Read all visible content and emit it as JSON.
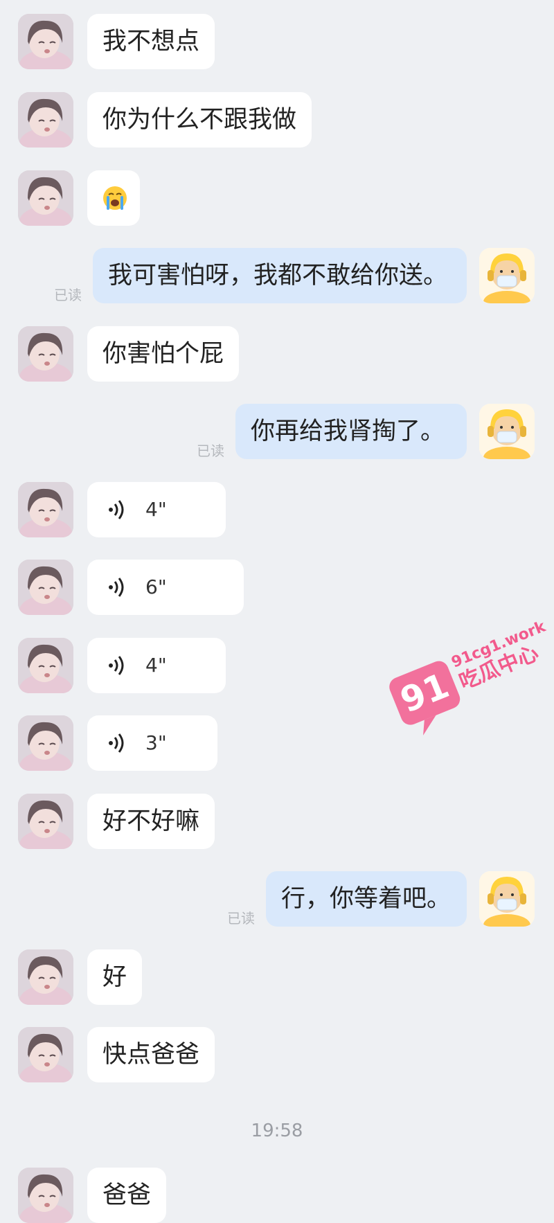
{
  "messages": [
    {
      "side": "left",
      "text": "我不想点"
    },
    {
      "side": "left",
      "text": "你为什么不跟我做"
    },
    {
      "side": "left",
      "emoji": "loudly-crying-face"
    },
    {
      "side": "right",
      "text": "我可害怕呀，我都不敢给你送。",
      "status": "已读"
    },
    {
      "side": "left",
      "text": "你害怕个屁"
    },
    {
      "side": "right",
      "text": "你再给我肾掏了。",
      "status": "已读"
    },
    {
      "side": "left",
      "voice": "4\""
    },
    {
      "side": "left",
      "voice": "6\""
    },
    {
      "side": "left",
      "voice": "4\""
    },
    {
      "side": "left",
      "voice": "3\""
    },
    {
      "side": "left",
      "text": "好不好嘛"
    },
    {
      "side": "right",
      "text": "行，你等着吧。",
      "status": "已读"
    },
    {
      "side": "left",
      "text": "好"
    },
    {
      "side": "left",
      "text": "快点爸爸"
    },
    {
      "side": "left",
      "text": "爸爸"
    }
  ],
  "timestamp": "19:58",
  "watermark": {
    "number": "91",
    "domain": "91cg1.work",
    "name": "吃瓜中心",
    "color": "#f25a8c"
  }
}
